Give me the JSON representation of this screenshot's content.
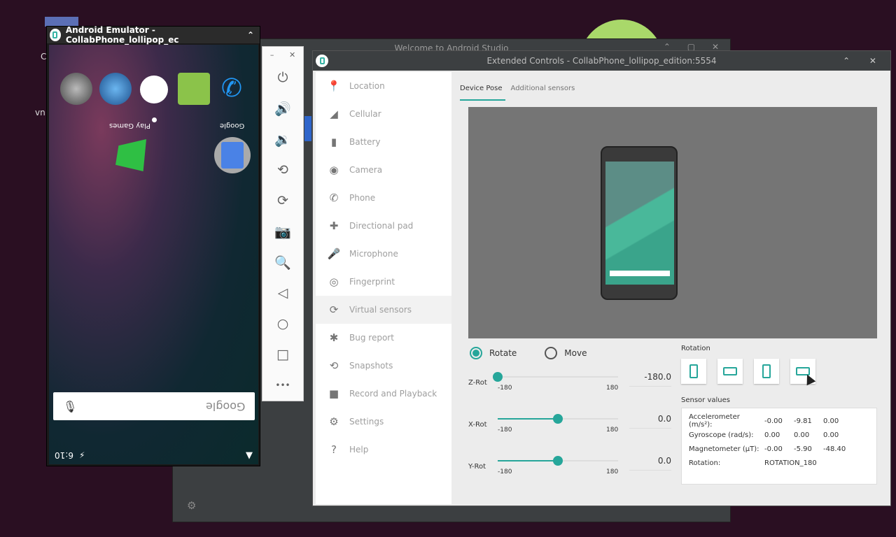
{
  "desktop": {
    "labels": [
      "C",
      "vn"
    ]
  },
  "studio": {
    "title": "Welcome to Android Studio",
    "controls": "⌃ ▢ ✕",
    "gear": "⚙"
  },
  "emulator": {
    "title": "Android Emulator - CollabPhone_lollipop_ec",
    "collapse": "⌃",
    "home_labels": {
      "play_games": "Play Games",
      "google": "Google"
    },
    "search_placeholder": "Google",
    "status_time": "6:10"
  },
  "toolbar": {
    "minimize": "–",
    "close": "✕",
    "tools": [
      {
        "icon": "power-icon",
        "glyph": "⏻"
      },
      {
        "icon": "volume-up-icon",
        "glyph": "🔊"
      },
      {
        "icon": "volume-down-icon",
        "glyph": "🔉"
      },
      {
        "icon": "rotate-left-icon",
        "glyph": "⟲"
      },
      {
        "icon": "rotate-right-icon",
        "glyph": "⟳"
      },
      {
        "icon": "camera-icon",
        "glyph": "📷"
      },
      {
        "icon": "zoom-icon",
        "glyph": "🔍"
      },
      {
        "icon": "back-icon",
        "glyph": "◁"
      },
      {
        "icon": "home-icon",
        "glyph": "○"
      },
      {
        "icon": "overview-icon",
        "glyph": "□"
      },
      {
        "icon": "more-icon",
        "glyph": "•••"
      }
    ]
  },
  "extended": {
    "title": "Extended Controls - CollabPhone_lollipop_edition:5554",
    "controls": "⌃ ✕",
    "sidebar": [
      {
        "label": "Location",
        "glyph": "📍"
      },
      {
        "label": "Cellular",
        "glyph": "◢"
      },
      {
        "label": "Battery",
        "glyph": "▮"
      },
      {
        "label": "Camera",
        "glyph": "◉"
      },
      {
        "label": "Phone",
        "glyph": "✆"
      },
      {
        "label": "Directional pad",
        "glyph": "✚"
      },
      {
        "label": "Microphone",
        "glyph": "🎤"
      },
      {
        "label": "Fingerprint",
        "glyph": "◎"
      },
      {
        "label": "Virtual sensors",
        "glyph": "⟳"
      },
      {
        "label": "Bug report",
        "glyph": "✱"
      },
      {
        "label": "Snapshots",
        "glyph": "⟲"
      },
      {
        "label": "Record and Playback",
        "glyph": "■"
      },
      {
        "label": "Settings",
        "glyph": "⚙"
      },
      {
        "label": "Help",
        "glyph": "?"
      }
    ],
    "active_index": 8,
    "tabs": [
      "Device Pose",
      "Additional sensors"
    ],
    "mode": {
      "rotate": "Rotate",
      "move": "Move",
      "selected": "rotate"
    },
    "sliders": [
      {
        "label": "Z-Rot",
        "min": "-180",
        "max": "180",
        "value": "-180.0",
        "fraction": 0.0
      },
      {
        "label": "X-Rot",
        "min": "-180",
        "max": "180",
        "value": "0.0",
        "fraction": 0.5
      },
      {
        "label": "Y-Rot",
        "min": "-180",
        "max": "180",
        "value": "0.0",
        "fraction": 0.5
      }
    ],
    "rotation_label": "Rotation",
    "rotation_buttons": [
      "portrait",
      "landscape",
      "reverse-portrait",
      "reverse-landscape"
    ],
    "sensor_values_label": "Sensor values",
    "sensor_values": [
      {
        "name": "Accelerometer (m/s²):",
        "values": [
          "-0.00",
          "-9.81",
          "0.00"
        ]
      },
      {
        "name": "Gyroscope (rad/s):",
        "values": [
          "0.00",
          "0.00",
          "0.00"
        ]
      },
      {
        "name": "Magnetometer (μT):",
        "values": [
          "-0.00",
          "-5.90",
          "-48.40"
        ]
      },
      {
        "name": "Rotation:",
        "values": [
          "ROTATION_180"
        ]
      }
    ]
  }
}
